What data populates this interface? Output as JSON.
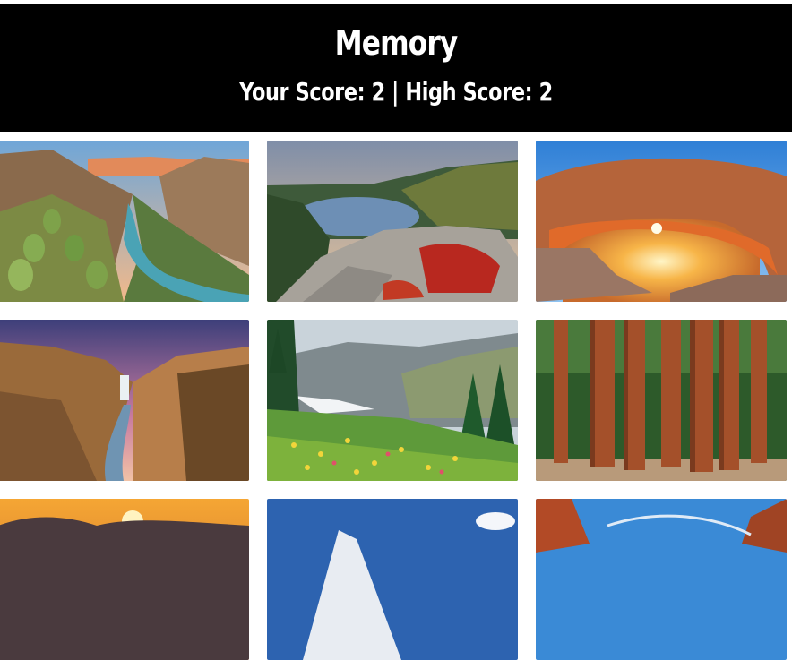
{
  "game": {
    "title": "Memory",
    "score_label": "Your Score:",
    "score": "2",
    "high_score_label": "High Score:",
    "high_score": "2",
    "separator": "|"
  },
  "cards": [
    {
      "name": "desert-canyon-river-cactus"
    },
    {
      "name": "mountain-lake-red-shrubs"
    },
    {
      "name": "sunrise-rock-arch"
    },
    {
      "name": "canyon-waterfall"
    },
    {
      "name": "wildflower-meadow-mountains"
    },
    {
      "name": "giant-sequoia-forest"
    },
    {
      "name": "sunset-clouds"
    },
    {
      "name": "snowy-peak-blue-sky"
    },
    {
      "name": "red-rock-canyon"
    }
  ],
  "colors": {
    "header_bg": "#000000",
    "header_text": "#ffffff",
    "page_bg": "#ffffff"
  }
}
